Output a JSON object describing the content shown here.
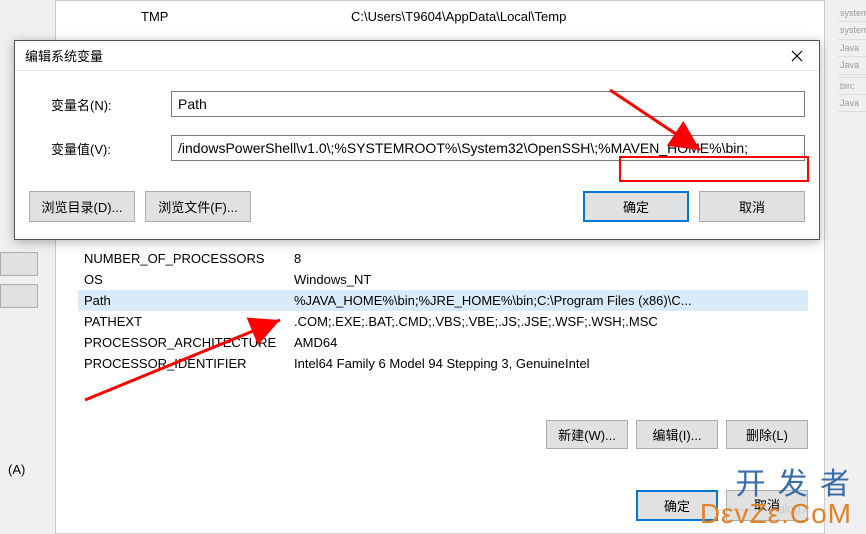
{
  "bg": {
    "top_var_name": "TMP",
    "top_var_value": "C:\\Users\\T9604\\AppData\\Local\\Temp",
    "vars": [
      {
        "name": "NUMBER_OF_PROCESSORS",
        "value": "8"
      },
      {
        "name": "OS",
        "value": "Windows_NT"
      },
      {
        "name": "Path",
        "value": "%JAVA_HOME%\\bin;%JRE_HOME%\\bin;C:\\Program Files (x86)\\C..."
      },
      {
        "name": "PATHEXT",
        "value": ".COM;.EXE;.BAT;.CMD;.VBS;.VBE;.JS;.JSE;.WSF;.WSH;.MSC"
      },
      {
        "name": "PROCESSOR_ARCHITECTURE",
        "value": "AMD64"
      },
      {
        "name": "PROCESSOR_IDENTIFIER",
        "value": "Intel64 Family 6 Model 94 Stepping 3, GenuineIntel"
      }
    ],
    "buttons1": {
      "new": "新建(W)...",
      "edit": "编辑(I)...",
      "delete": "删除(L)"
    },
    "buttons2": {
      "ok": "确定",
      "cancel": "取消"
    },
    "left_tab": "(A)"
  },
  "dialog": {
    "title": "编辑系统变量",
    "name_label": "变量名(N):",
    "name_value": "Path",
    "value_label": "变量值(V):",
    "value_value": "/indowsPowerShell\\v1.0\\;%SYSTEMROOT%\\System32\\OpenSSH\\;%MAVEN_HOME%\\bin;",
    "browse_dir": "浏览目录(D)...",
    "browse_file": "浏览文件(F)...",
    "ok": "确定",
    "cancel": "取消"
  },
  "watermark": {
    "line1": "开 发 者",
    "line2": "DεvZε.CοM",
    "faint": "————— blog.c"
  },
  "side_stubs": [
    "system:",
    "system:",
    "Java",
    "Java",
    "",
    "bin;",
    "Java"
  ]
}
